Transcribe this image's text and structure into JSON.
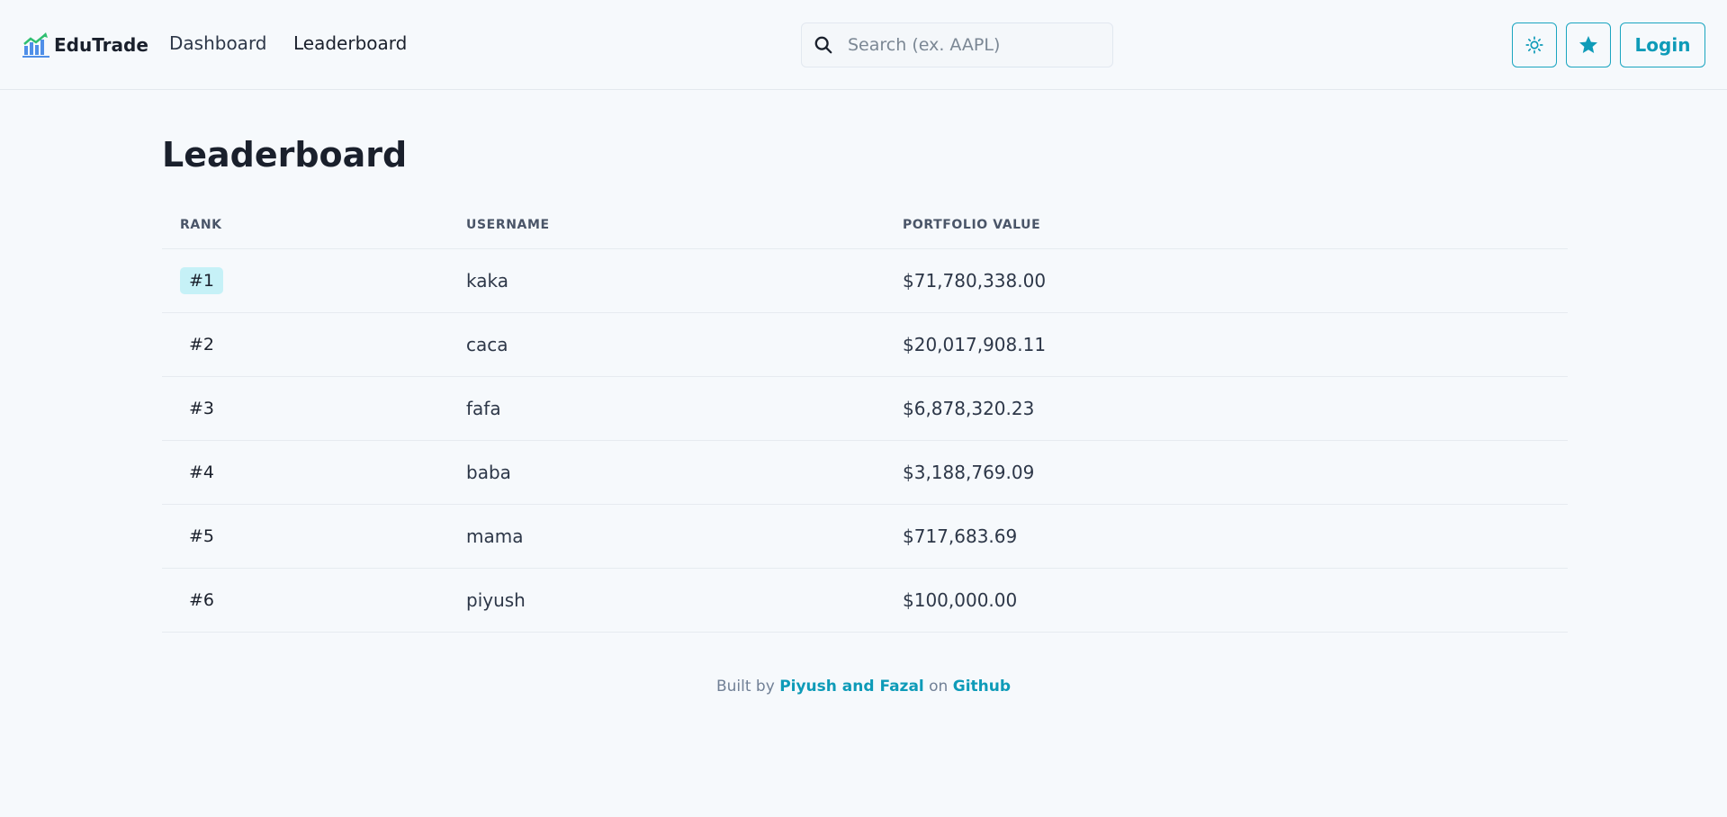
{
  "header": {
    "brand_name": "EduTrade",
    "nav": {
      "dashboard": "Dashboard",
      "leaderboard": "Leaderboard"
    },
    "search": {
      "placeholder": "Search (ex. AAPL)",
      "value": ""
    },
    "login_label": "Login"
  },
  "main": {
    "title": "Leaderboard",
    "table": {
      "columns": [
        "RANK",
        "USERNAME",
        "PORTFOLIO VALUE"
      ],
      "rows": [
        {
          "rank": "#1",
          "username": "kaka",
          "value": "$71,780,338.00"
        },
        {
          "rank": "#2",
          "username": "caca",
          "value": "$20,017,908.11"
        },
        {
          "rank": "#3",
          "username": "fafa",
          "value": "$6,878,320.23"
        },
        {
          "rank": "#4",
          "username": "baba",
          "value": "$3,188,769.09"
        },
        {
          "rank": "#5",
          "username": "mama",
          "value": "$717,683.69"
        },
        {
          "rank": "#6",
          "username": "piyush",
          "value": "$100,000.00"
        }
      ]
    }
  },
  "footer": {
    "built_by": "Built by",
    "authors": "Piyush and Fazal",
    "on": "on",
    "github": "Github"
  },
  "colors": {
    "accent": "#0e9bb8",
    "badge_highlight": "#c6f1f7",
    "background": "#f6f9fc"
  },
  "icons": {
    "logo": "chart-logo-icon",
    "search": "search-icon",
    "theme": "sun-icon",
    "favorites": "star-icon"
  }
}
